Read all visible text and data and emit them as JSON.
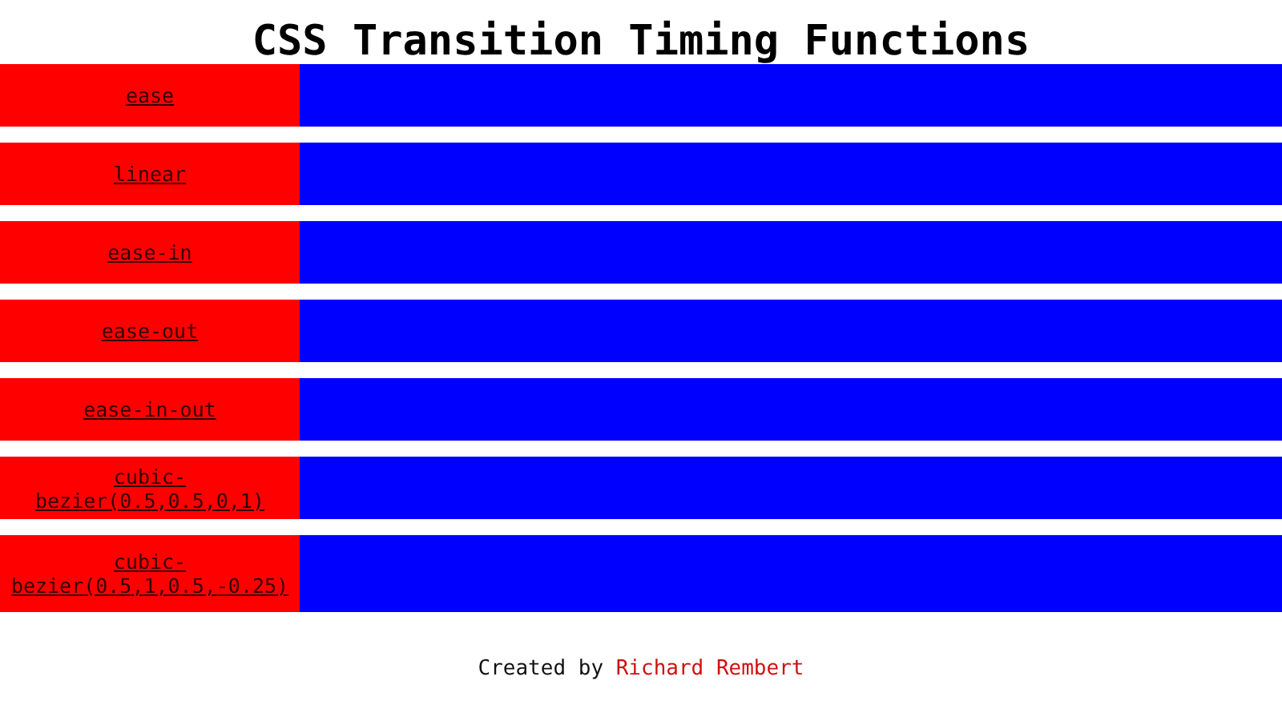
{
  "title": "CSS Transition Timing Functions",
  "rows": [
    {
      "label": "ease"
    },
    {
      "label": "linear"
    },
    {
      "label": "ease-in"
    },
    {
      "label": "ease-out"
    },
    {
      "label": "ease-in-out"
    },
    {
      "label": "cubic-bezier(0.5,0.5,0,1)"
    },
    {
      "label": "cubic-bezier(0.5,1,0.5,-0.25)"
    }
  ],
  "footer": {
    "text": "Created by",
    "link": "Richard Rembert"
  }
}
